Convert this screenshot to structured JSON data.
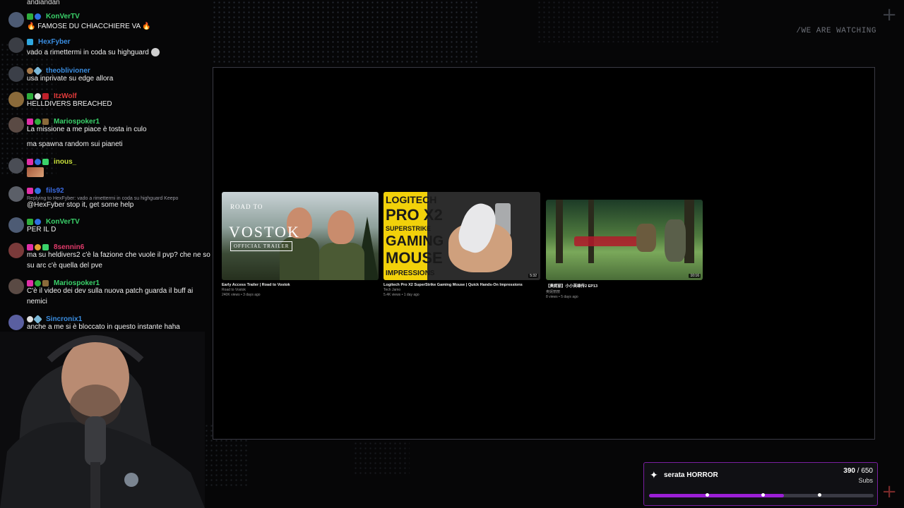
{
  "overlay": {
    "watch_text": "/WE ARE WATCHING"
  },
  "chat": {
    "top_cut": "andiandan",
    "messages": [
      {
        "user": "KonVerTV",
        "color": "#3ad26a",
        "text": "🔥 FAMOSE DU CHIACCHIERE VA 🔥"
      },
      {
        "user": "HexFyber",
        "color": "#3a8de0",
        "text": "vado a rimettermi in coda su highguard"
      },
      {
        "user": "theoblivioner",
        "color": "#3a8de0",
        "text": "usa inprivate su edge allora"
      },
      {
        "user": "ItzWolf",
        "color": "#e03a3a",
        "text": "HELLDIVERS BREACHED"
      },
      {
        "user": "Mariospoker1",
        "color": "#3ad26a",
        "text": "La missione a me piace è tosta in culo"
      },
      {
        "user": "",
        "color": "#3ad26a",
        "text": "ma spawna random sui pianeti"
      },
      {
        "user": "inous_",
        "color": "#c8e03a",
        "text": ""
      },
      {
        "user": "fils92",
        "color": "#3a6ae0",
        "reply": "Replying to HexFyber: vado a rimettermi in coda su highguard Keepo",
        "text": "@HexFyber stop it, get some help"
      },
      {
        "user": "KonVerTV",
        "color": "#3ad26a",
        "text": "PER IL D"
      },
      {
        "user": "8sennin6",
        "color": "#e03a6a",
        "text": "ma su heldivers2 c'è la fazione che vuole il pvp? che ne so su arc c'è quella del pve"
      },
      {
        "user": "Mariospoker1",
        "color": "#3ad26a",
        "text": "C'è il video dei dev sulla nuova patch guarda il buff ai nemici"
      },
      {
        "user": "Sincronix1",
        "color": "#3a8de0",
        "text": "anche a me si è bloccato in questo instante haha"
      }
    ]
  },
  "videos": [
    {
      "title": "Early Access Trailer | Road to Vostok",
      "channel": "Road to Vostok",
      "stats": "240K views • 3 days ago",
      "thumb_text": {
        "top": "ROAD TO",
        "main": "VOSTOK",
        "badge": "OFFICIAL TRAILER"
      }
    },
    {
      "title": "Logitech Pro X2 SuperStrike Gaming Mouse | Quick Hands-On Impressions",
      "channel": "Tech Jamo",
      "stats": "5.4K views • 1 day ago",
      "duration": "5:32",
      "thumb_text": {
        "l1": "LOGITECH",
        "l2": "PRO X2",
        "l3": "SUPERSTRIKE",
        "l4": "GAMING",
        "l5": "MOUSE",
        "l6": "IMPRESSIONS"
      }
    },
    {
      "title": "【奥妮丽】小小英雄传2 EP13",
      "channel": "奥妮丽丽",
      "stats": "8 views • 5 days ago",
      "duration": "10:16"
    }
  ],
  "goal": {
    "title": "serata HORROR",
    "current": "390",
    "target": "650",
    "unit": "Subs",
    "progress": 0.6,
    "accent": "#9b1fd6"
  }
}
